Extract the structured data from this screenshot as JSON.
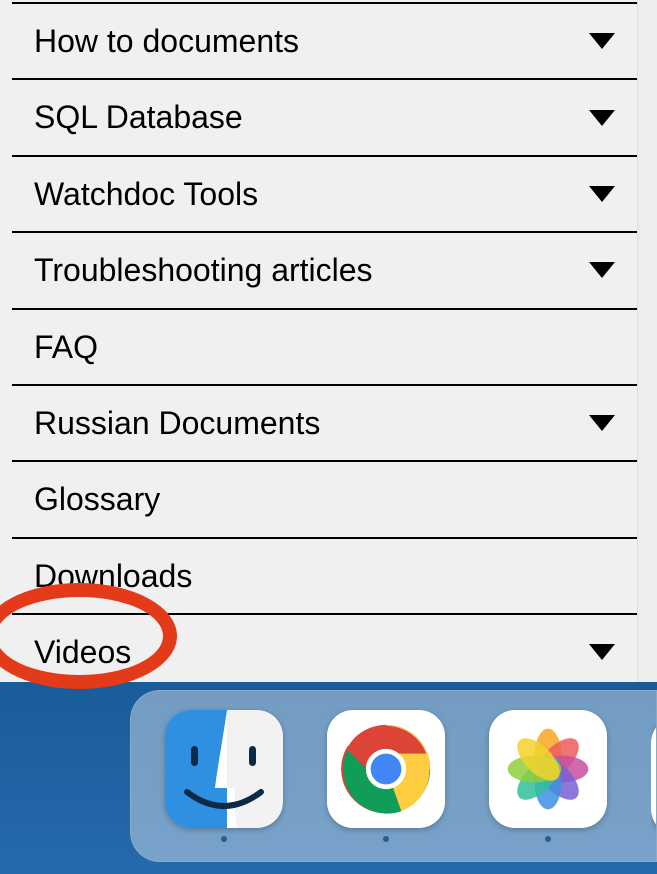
{
  "sidebar": {
    "items": [
      {
        "label": "How to documents",
        "expandable": true
      },
      {
        "label": "SQL Database",
        "expandable": true
      },
      {
        "label": "Watchdoc Tools",
        "expandable": true
      },
      {
        "label": "Troubleshooting articles",
        "expandable": true
      },
      {
        "label": "FAQ",
        "expandable": false
      },
      {
        "label": "Russian Documents",
        "expandable": true
      },
      {
        "label": "Glossary",
        "expandable": false
      },
      {
        "label": "Downloads",
        "expandable": false
      },
      {
        "label": "Videos",
        "expandable": true,
        "highlighted": true
      }
    ]
  },
  "dock": {
    "apps": [
      {
        "name": "Finder",
        "running": true
      },
      {
        "name": "Google Chrome",
        "running": true
      },
      {
        "name": "Photos",
        "running": true
      }
    ]
  },
  "colors": {
    "highlight": "#e33a1a",
    "desktop_bg": "#1f62a2"
  }
}
